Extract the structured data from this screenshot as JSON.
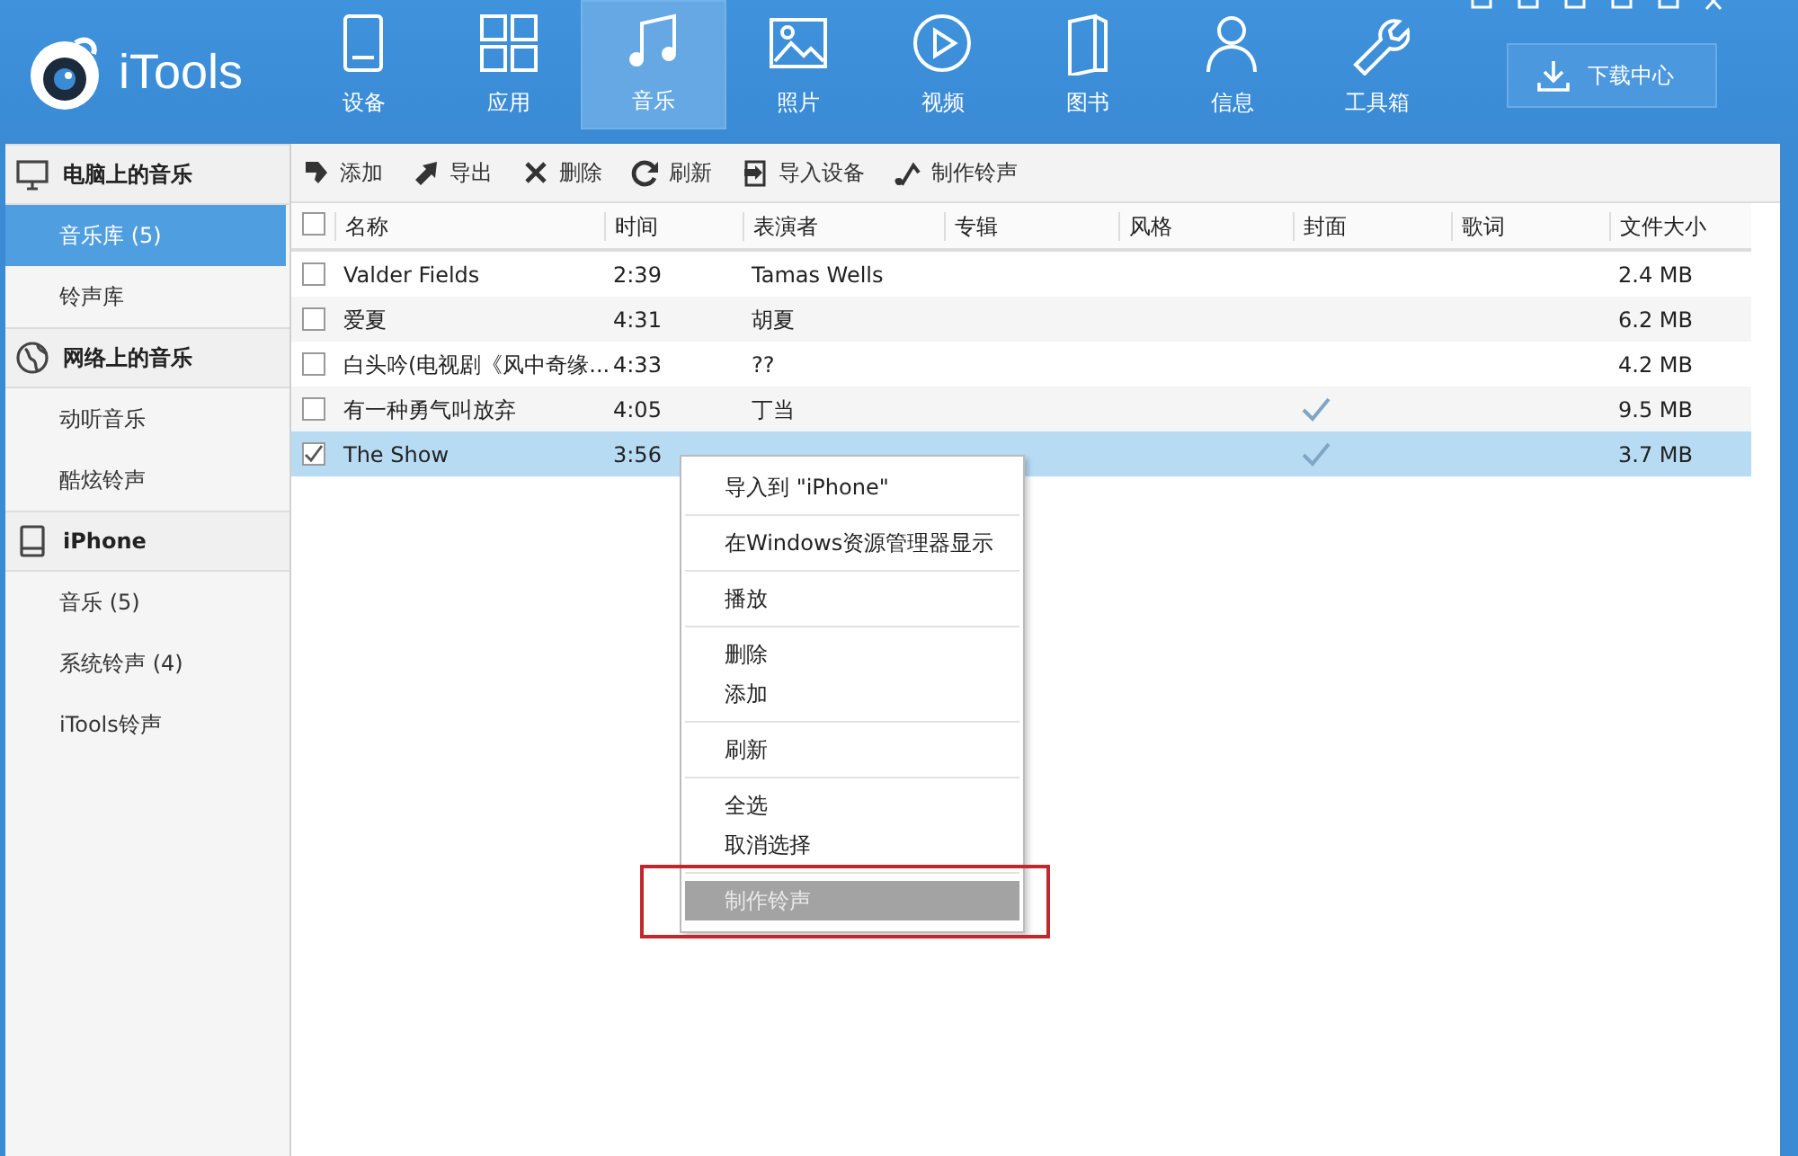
{
  "app": {
    "name": "iTools"
  },
  "nav": [
    {
      "label": "设备",
      "selected": false
    },
    {
      "label": "应用",
      "selected": false
    },
    {
      "label": "音乐",
      "selected": true
    },
    {
      "label": "照片",
      "selected": false
    },
    {
      "label": "视频",
      "selected": false
    },
    {
      "label": "图书",
      "selected": false
    },
    {
      "label": "信息",
      "selected": false
    },
    {
      "label": "工具箱",
      "selected": false
    }
  ],
  "download_button": {
    "label": "下载中心"
  },
  "sidebar": [
    {
      "title": "电脑上的音乐",
      "items": [
        {
          "label": "音乐库 (5)",
          "selected": true
        },
        {
          "label": "铃声库",
          "selected": false
        }
      ]
    },
    {
      "title": "网络上的音乐",
      "items": [
        {
          "label": "动听音乐",
          "selected": false
        },
        {
          "label": "酷炫铃声",
          "selected": false
        }
      ]
    },
    {
      "title": "iPhone",
      "items": [
        {
          "label": "音乐 (5)",
          "selected": false
        },
        {
          "label": "系统铃声 (4)",
          "selected": false
        },
        {
          "label": "iTools铃声",
          "selected": false
        }
      ]
    }
  ],
  "toolbar": [
    {
      "label": "添加"
    },
    {
      "label": "导出"
    },
    {
      "label": "删除"
    },
    {
      "label": "刷新"
    },
    {
      "label": "导入设备"
    },
    {
      "label": "制作铃声"
    }
  ],
  "table": {
    "all_checked": false,
    "columns": [
      "名称",
      "时间",
      "表演者",
      "专辑",
      "风格",
      "封面",
      "歌词",
      "文件大小"
    ],
    "rows": [
      {
        "name": "Valder Fields",
        "time": "2:39",
        "artist": "Tamas Wells",
        "cover": false,
        "size": "2.4 MB",
        "checked": false,
        "selected": false
      },
      {
        "name": "爱夏",
        "time": "4:31",
        "artist": "胡夏",
        "cover": false,
        "size": "6.2 MB",
        "checked": false,
        "selected": false
      },
      {
        "name": "白头吟(电视剧《风中奇缘...",
        "time": "4:33",
        "artist": "??",
        "cover": false,
        "size": "4.2 MB",
        "checked": false,
        "selected": false
      },
      {
        "name": "有一种勇气叫放弃",
        "time": "4:05",
        "artist": "丁当",
        "cover": true,
        "size": "9.5 MB",
        "checked": false,
        "selected": false
      },
      {
        "name": "The Show",
        "time": "3:56",
        "cover": true,
        "size": "3.7 MB",
        "checked": true,
        "selected": true
      }
    ]
  },
  "context_menu": {
    "groups": [
      [
        {
          "label": "导入到 \"iPhone\"",
          "selected": false
        }
      ],
      [
        {
          "label": "在Windows资源管理器显示",
          "selected": false
        }
      ],
      [
        {
          "label": "播放",
          "selected": false
        }
      ],
      [
        {
          "label": "删除",
          "selected": false
        },
        {
          "label": "添加",
          "selected": false
        }
      ],
      [
        {
          "label": "刷新",
          "selected": false
        }
      ],
      [
        {
          "label": "全选",
          "selected": false
        },
        {
          "label": "取消选择",
          "selected": false
        }
      ],
      [
        {
          "label": "制作铃声",
          "selected": true
        }
      ]
    ]
  }
}
